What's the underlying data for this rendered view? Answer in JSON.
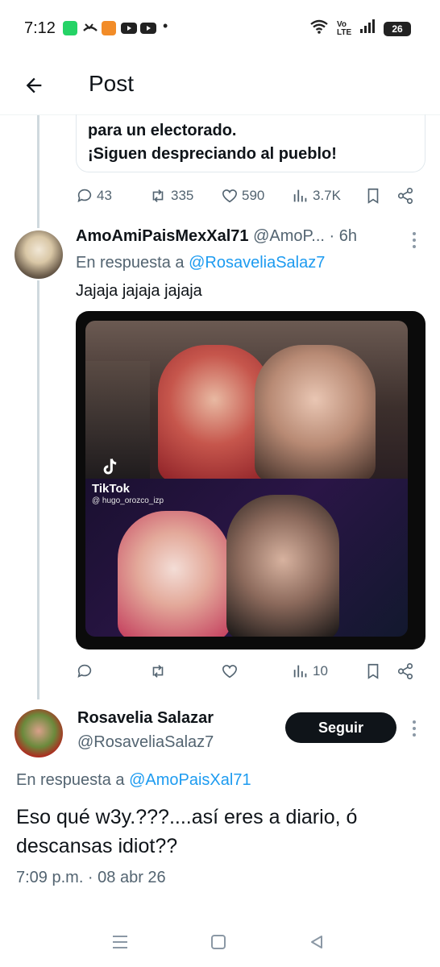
{
  "status_bar": {
    "time": "7:12",
    "network": "Vo LTE",
    "battery": "26",
    "dot": "•",
    "icons": [
      "whatsapp-icon",
      "missed-call-icon",
      "app-icon",
      "youtube-icon",
      "youtube-icon",
      "wifi-icon",
      "signal-icon",
      "battery-icon"
    ]
  },
  "header": {
    "title": "Post",
    "back_icon": "arrow-left-icon"
  },
  "quoted_card": {
    "lines": [
      "para un electorado.",
      "¡Siguen despreciando al pueblo!"
    ]
  },
  "parent_actions": {
    "replies": "43",
    "reposts": "335",
    "likes": "590",
    "views": "3.7K"
  },
  "reply": {
    "name": "AmoAmiPaisMexXal71",
    "handle": "@AmoP...",
    "time": "· 6h",
    "reply_prefix": "En respuesta a ",
    "reply_to": "@RosaveliaSalaz7",
    "text": "Jajaja jajaja jajaja",
    "media": {
      "watermark": "TikTok",
      "watermark_handle": "@ hugo_orozco_izp"
    },
    "actions": {
      "views": "10"
    }
  },
  "main": {
    "name": "Rosavelia Salazar",
    "handle": "@RosaveliaSalaz7",
    "follow_label": "Seguir",
    "reply_prefix": "En respuesta a ",
    "reply_to": "@AmoPaisXal71",
    "text": "Eso qué w3y.???....así eres a diario, ó descansas idiot??",
    "timestamp": "7:09 p.m. · 08 abr 26"
  },
  "colors": {
    "accent": "#1d9bf0",
    "text": "#0f1419",
    "muted": "#536471",
    "border": "#e1e8ed",
    "follow_bg": "#0f1419"
  }
}
